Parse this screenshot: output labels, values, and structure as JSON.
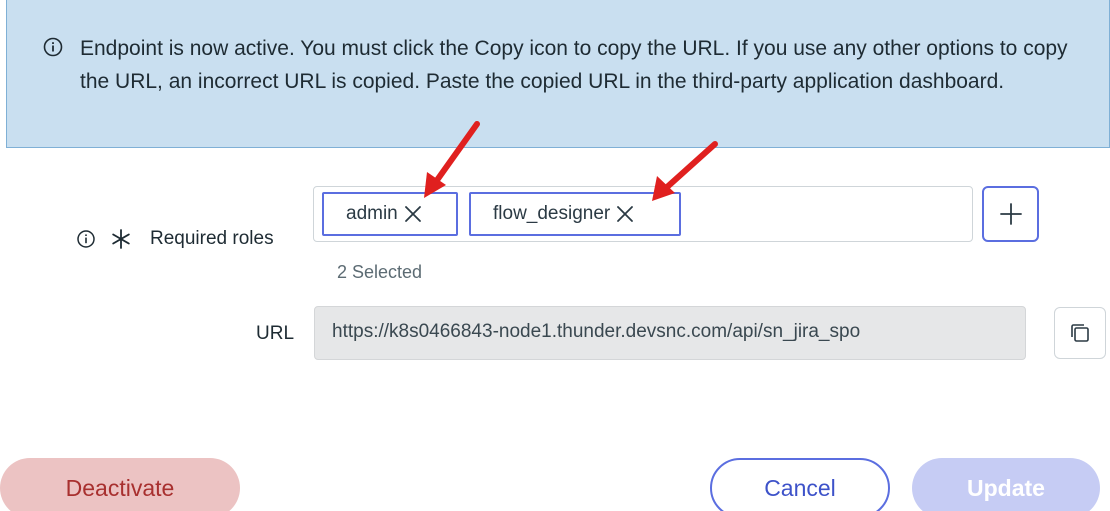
{
  "banner": {
    "icon": "info-icon",
    "message": "Endpoint is now active. You must click the Copy icon to copy the URL. If you use any other options to copy the URL, an incorrect URL is copied. Paste the copied URL in the third-party application dashboard."
  },
  "roles": {
    "label": "Required roles",
    "info_icon": "info-icon",
    "required_icon": "asterisk-icon",
    "chips": [
      {
        "label": "admin",
        "remove_icon": "close-icon"
      },
      {
        "label": "flow_designer",
        "remove_icon": "close-icon"
      }
    ],
    "add_icon": "plus-icon",
    "selected_count": "2 Selected"
  },
  "url": {
    "label": "URL",
    "value": "https://k8s0466843-node1.thunder.devsnc.com/api/sn_jira_spo",
    "copy_icon": "copy-icon"
  },
  "footer": {
    "deactivate_label": "Deactivate",
    "cancel_label": "Cancel",
    "update_label": "Update"
  },
  "colors": {
    "banner_bg": "#c9dff0",
    "accent": "#5b6ee0",
    "annotation_arrow": "#e0201f",
    "deactivate_bg": "#ecc3c3",
    "update_disabled_bg": "#c6ccf4"
  }
}
